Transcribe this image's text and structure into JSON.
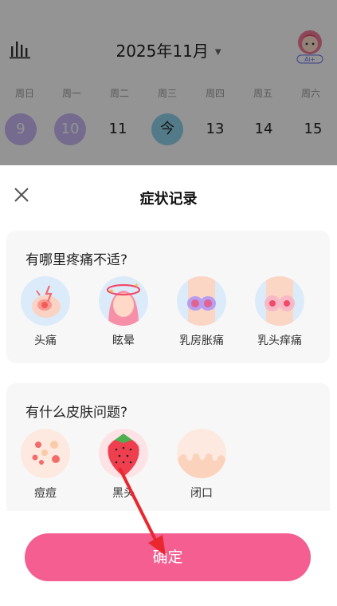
{
  "calendar": {
    "month_title": "2025年11月",
    "weekdays": [
      "周日",
      "周一",
      "周二",
      "周三",
      "周四",
      "周五",
      "周六"
    ],
    "dates": [
      "9",
      "10",
      "11",
      "今",
      "13",
      "14",
      "15"
    ],
    "avatar_badge": "Ai+"
  },
  "sheet": {
    "title": "症状记录",
    "confirm_label": "确定"
  },
  "pain_section": {
    "title": "有哪里疼痛不适?",
    "options": [
      {
        "label": "头痛",
        "icon": "headache-icon"
      },
      {
        "label": "眩晕",
        "icon": "dizziness-icon"
      },
      {
        "label": "乳房胀痛",
        "icon": "breast-swelling-icon"
      },
      {
        "label": "乳头痒痛",
        "icon": "nipple-itch-icon"
      }
    ]
  },
  "skin_section": {
    "title": "有什么皮肤问题?",
    "options": [
      {
        "label": "痘痘",
        "icon": "acne-icon"
      },
      {
        "label": "黑头",
        "icon": "blackhead-strawberry-icon"
      },
      {
        "label": "闭口",
        "icon": "closed-comedone-icon"
      }
    ]
  },
  "colors": {
    "accent": "#f45e91",
    "purple_day": "#c8b9f4",
    "today": "#8fd3ea",
    "annotation_arrow": "#e8282e"
  }
}
